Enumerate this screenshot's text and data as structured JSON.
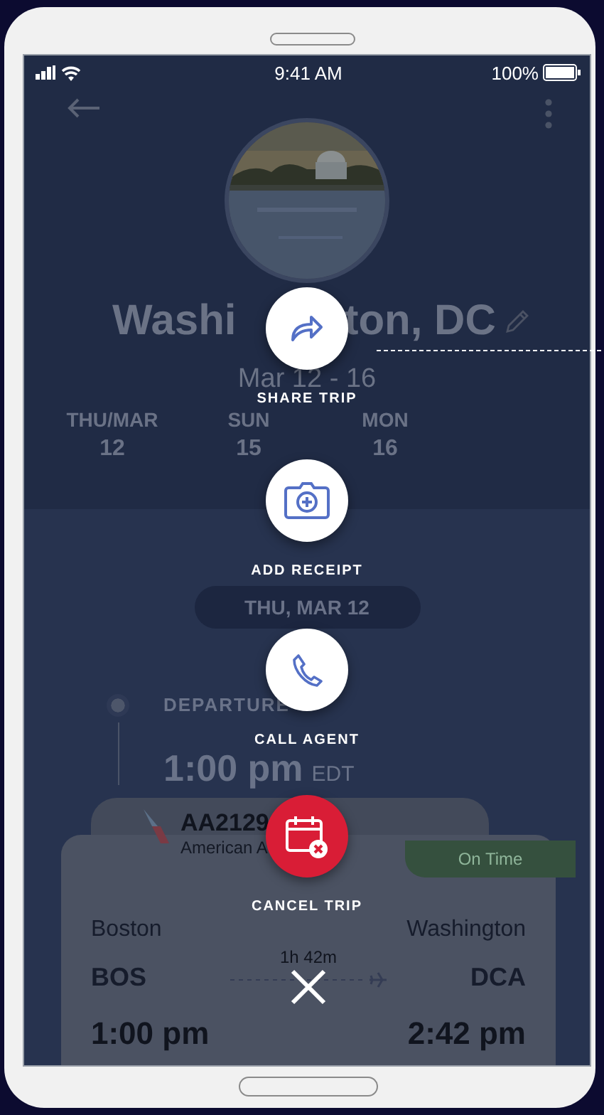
{
  "status_bar": {
    "time": "9:41 AM",
    "battery": "100%"
  },
  "trip": {
    "title_parts": [
      "Washi",
      "ton, DC"
    ],
    "dates": "Mar 12 - 16",
    "days": [
      {
        "day": "THU/MAR",
        "date": "12"
      },
      {
        "day": "SUN",
        "date": "15"
      },
      {
        "day": "MON",
        "date": "16"
      }
    ]
  },
  "date_pill": "THU, MAR 12",
  "departure": {
    "label": "DEPARTURE",
    "time": "1:00 pm",
    "zone": "EDT"
  },
  "flight": {
    "number": "AA2129",
    "airline": "American A",
    "status": "On Time",
    "from_city": "Boston",
    "to_city": "Washington",
    "duration": "1h 42m",
    "from_code": "BOS",
    "to_code": "DCA",
    "depart": "1:00 pm",
    "arrive": "2:42 pm"
  },
  "actions": [
    {
      "label": "SHARE TRIP",
      "kind": "share"
    },
    {
      "label": "ADD RECEIPT",
      "kind": "receipt"
    },
    {
      "label": "CALL AGENT",
      "kind": "call"
    },
    {
      "label": "CANCEL TRIP",
      "kind": "cancel"
    }
  ]
}
